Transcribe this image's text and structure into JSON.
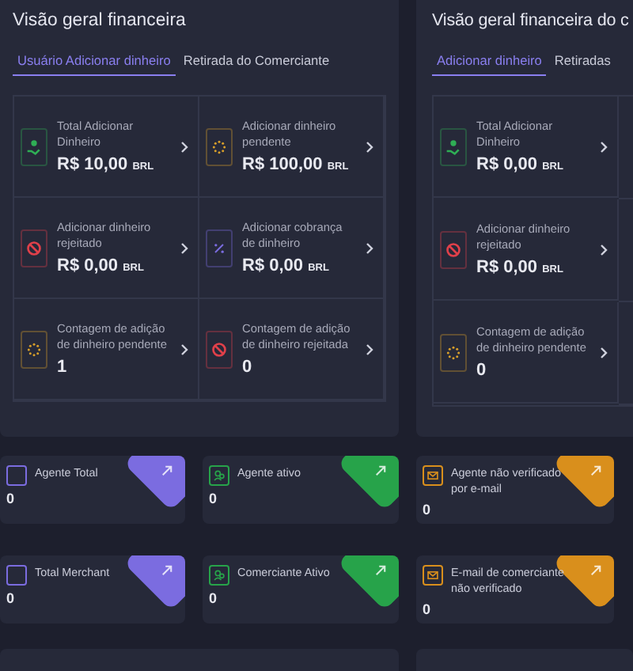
{
  "panels": [
    {
      "title": "Visão geral financeira",
      "tabs": [
        {
          "label": "Usuário Adicionar dinheiro",
          "selected": true
        },
        {
          "label": "Retirada do Comerciante",
          "selected": false
        }
      ],
      "tiles": [
        {
          "kind": "money",
          "label": "Total Adicionar Dinheiro",
          "amount": "R$ 10,00",
          "currency": "BRL"
        },
        {
          "kind": "pending",
          "label": "Adicionar dinheiro pendente",
          "amount": "R$ 100,00",
          "currency": "BRL"
        },
        {
          "kind": "rejected",
          "label": "Adicionar dinheiro rejeitado",
          "amount": "R$ 0,00",
          "currency": "BRL"
        },
        {
          "kind": "fee",
          "label": "Adicionar cobrança de dinheiro",
          "amount": "R$ 0,00",
          "currency": "BRL"
        },
        {
          "kind": "pending",
          "label": "Contagem de adição de dinheiro pendente",
          "amount": "1"
        },
        {
          "kind": "rejected",
          "label": "Contagem de adição de dinheiro rejeitada",
          "amount": "0"
        }
      ]
    },
    {
      "title": "Visão geral financeira do c",
      "tabs": [
        {
          "label": "Adicionar dinheiro",
          "selected": true
        },
        {
          "label": "Retiradas",
          "selected": false
        }
      ],
      "tiles": [
        {
          "kind": "money",
          "label": "Total Adicionar Dinheiro",
          "amount": "R$ 0,00",
          "currency": "BRL"
        },
        {
          "kind": "rejected",
          "label": "Adicionar dinheiro rejeitado",
          "amount": "R$ 0,00",
          "currency": "BRL"
        },
        {
          "kind": "pending",
          "label": "Contagem de adição de dinheiro pendente",
          "amount": "0"
        }
      ]
    }
  ],
  "stat_cards": [
    {
      "kind": "agent",
      "color": "#7b6ce0",
      "label": "Agente Total",
      "value": "0"
    },
    {
      "kind": "active",
      "color": "#27a34a",
      "label": "Agente ativo",
      "value": "0"
    },
    {
      "kind": "mail",
      "color": "#d98f1c",
      "label": "Agente não verificado por e-mail",
      "value": "0"
    },
    {
      "kind": "agent",
      "color": "#7b6ce0",
      "label": "Total Merchant",
      "value": "0"
    },
    {
      "kind": "active",
      "color": "#27a34a",
      "label": "Comerciante Ativo",
      "value": "0"
    },
    {
      "kind": "mail",
      "color": "#d98f1c",
      "label": "E-mail de comerciante não verificado",
      "value": "0"
    }
  ]
}
